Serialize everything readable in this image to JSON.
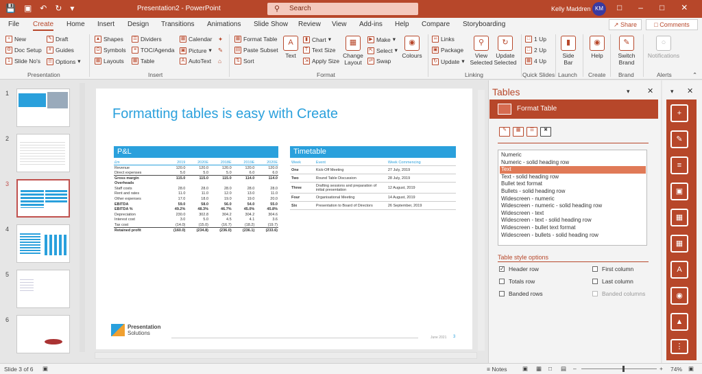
{
  "titlebar": {
    "doc_title": "Presentation2 - PowerPoint",
    "search_placeholder": "Search",
    "user": "Kelly Maddren",
    "initials": "KM",
    "colors": {
      "brand": "#b7472a"
    }
  },
  "tabs": [
    "File",
    "Create",
    "Home",
    "Insert",
    "Design",
    "Transitions",
    "Animations",
    "Slide Show",
    "Review",
    "View",
    "Add-ins",
    "Help",
    "Compare",
    "Storyboarding"
  ],
  "share": "Share",
  "comments": "Comments",
  "ribbon": {
    "presentation": {
      "new": "New",
      "draft": "Draft",
      "doc_setup": "Doc Setup",
      "guides": "Guides",
      "slide_nos": "Slide No's",
      "options": "Options",
      "label": "Presentation"
    },
    "insert": {
      "shapes": "Shapes",
      "dividers": "Dividers",
      "calendar": "Calendar",
      "symbols": "Symbols",
      "toc": "TOC/Agenda",
      "picture": "Picture",
      "layouts": "Layouts",
      "table": "Table",
      "autotext": "AutoText",
      "label": "Insert"
    },
    "format": {
      "format_table": "Format Table",
      "paste_subset": "Paste Subset",
      "sort": "Sort",
      "text": "Text",
      "chart": "Chart",
      "text_size": "Text Size",
      "apply_size": "Apply Size",
      "change_layout": "Change Layout",
      "make": "Make",
      "select": "Select",
      "swap": "Swap",
      "colours": "Colours",
      "label": "Format"
    },
    "linking": {
      "links": "Links",
      "package": "Package",
      "update": "Update",
      "view_selected": "View Selected",
      "update_selected": "Update Selected",
      "label": "Linking"
    },
    "quick": {
      "up1": "1 Up",
      "up2": "2 Up",
      "up4": "4 Up",
      "label": "Quick Slides"
    },
    "launch": {
      "side_bar": "Side Bar",
      "label": "Launch"
    },
    "create": {
      "help": "Help",
      "label": "Create"
    },
    "brand": {
      "switch_brand": "Switch Brand",
      "label": "Brand"
    },
    "alerts": {
      "notifications": "Notifications",
      "label": "Alerts"
    }
  },
  "thumbs": [
    "1",
    "2",
    "3",
    "4",
    "5",
    "6"
  ],
  "slide": {
    "title": "Formatting tables is easy with Create",
    "pl_title": "P&L",
    "pl_header": [
      "£m",
      "2019",
      "2020E",
      "2018E",
      "2019E",
      "2020E"
    ],
    "pl_rows": [
      [
        "Revenue",
        "120.0",
        "120.0",
        "120.0",
        "120.0",
        "120.0"
      ],
      [
        "Direct expenses",
        "5.0",
        "5.0",
        "5.0",
        "6.0",
        "6.0"
      ],
      [
        "Gross margin",
        "115.0",
        "115.0",
        "115.0",
        "114.0",
        "114.0"
      ],
      [
        "Overheads",
        "",
        "",
        "",
        "",
        ""
      ],
      [
        "Staff costs",
        "28.0",
        "28.0",
        "28.0",
        "28.0",
        "28.0"
      ],
      [
        "Rent and rates",
        "11.0",
        "11.0",
        "12.0",
        "13.0",
        "11.0"
      ],
      [
        "Other expenses",
        "17.0",
        "18.0",
        "19.0",
        "19.0",
        "20.0"
      ],
      [
        "EBITDA",
        "59.0",
        "58.0",
        "56.0",
        "54.0",
        "55.0"
      ],
      [
        "EBITDA %",
        "49.2%",
        "48.3%",
        "46.7%",
        "45.0%",
        "45.8%"
      ],
      [
        "Depreciation",
        "230.0",
        "302.8",
        "304.2",
        "304.2",
        "304.6"
      ],
      [
        "Interest cost",
        "3.0",
        "5.0",
        "4.5",
        "4.1",
        "3.6"
      ],
      [
        "Tax cost",
        "(14.0)",
        "(15.0)",
        "(16.7)",
        "(18.2)",
        "(19.7)"
      ],
      [
        "Retained profit",
        "(160.0)",
        "(234.8)",
        "(236.0)",
        "(236.1)",
        "(233.6)"
      ]
    ],
    "tl_title": "Timetable",
    "tl_header": [
      "Week",
      "Event",
      "Week Commencing"
    ],
    "tl_rows": [
      [
        "One",
        "Kick-Off Meeting",
        "27 July, 2019"
      ],
      [
        "Two",
        "Round Table Discussion",
        "28 July, 2019"
      ],
      [
        "Three",
        "Drafting sessions and preparation of initial presentation",
        "12 August, 2019"
      ],
      [
        "Four",
        "Organisational Meeting",
        "14 August, 2019"
      ],
      [
        "Six",
        "Presentation to Board of Directors",
        "26 September, 2019"
      ]
    ],
    "logo_line1": "Presentation",
    "logo_line2": "Solutions",
    "footer_date": "June 2021",
    "page_no": "3"
  },
  "pane": {
    "title": "Tables",
    "format_table": "Format Table",
    "styles": [
      "Numeric",
      "Numeric - solid heading row",
      "Text",
      "Text - solid heading row",
      "Bullet text format",
      "Bullets - solid heading row",
      "Widescreen - numeric",
      "Widescreen - numeric - solid heading row",
      "Widescreen - text",
      "Widescreen - text - solid heading row",
      "Widescreen - bullet text format",
      "Widescreen - bullets - solid heading row"
    ],
    "selected_style": "Text",
    "options_title": "Table style options",
    "opts": {
      "header_row": "Header row",
      "totals_row": "Totals row",
      "banded_rows": "Banded rows",
      "first_column": "First column",
      "last_column": "Last column",
      "banded_columns": "Banded columns"
    },
    "checked": [
      "Header row"
    ]
  },
  "status": {
    "slide": "Slide 3 of 6",
    "notes": "Notes",
    "zoom": "74%"
  }
}
